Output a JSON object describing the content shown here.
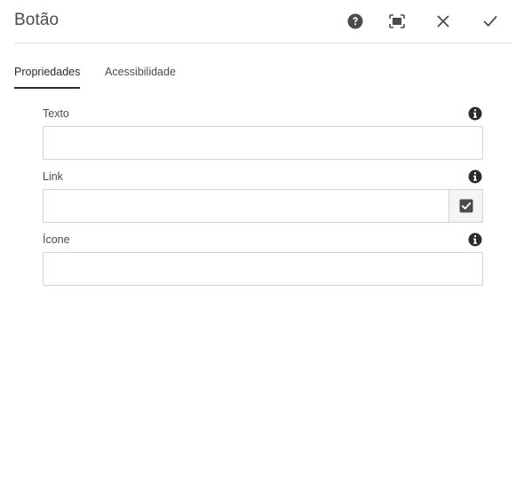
{
  "dialog": {
    "title": "Botão"
  },
  "header_actions": [
    {
      "name": "help",
      "icon": "help-icon"
    },
    {
      "name": "fullscreen",
      "icon": "fullscreen-icon"
    },
    {
      "name": "cancel",
      "icon": "close-icon"
    },
    {
      "name": "done",
      "icon": "check-icon"
    }
  ],
  "tabs": [
    {
      "label": "Propriedades",
      "active": true
    },
    {
      "label": "Acessibilidade",
      "active": false
    }
  ],
  "fields": {
    "text": {
      "label": "Texto",
      "value": "",
      "icon": "info-icon"
    },
    "link": {
      "label": "Link",
      "value": "",
      "icon": "info-icon",
      "picker_icon": "checkbox-checked-icon"
    },
    "icon": {
      "label": "Ícone",
      "value": "",
      "icon": "info-icon"
    }
  },
  "colors": {
    "text": "#4b4b4b",
    "border": "#d3d3d3",
    "icon_dark": "#2c2c2c",
    "picker_bg": "#f4f4f4"
  }
}
